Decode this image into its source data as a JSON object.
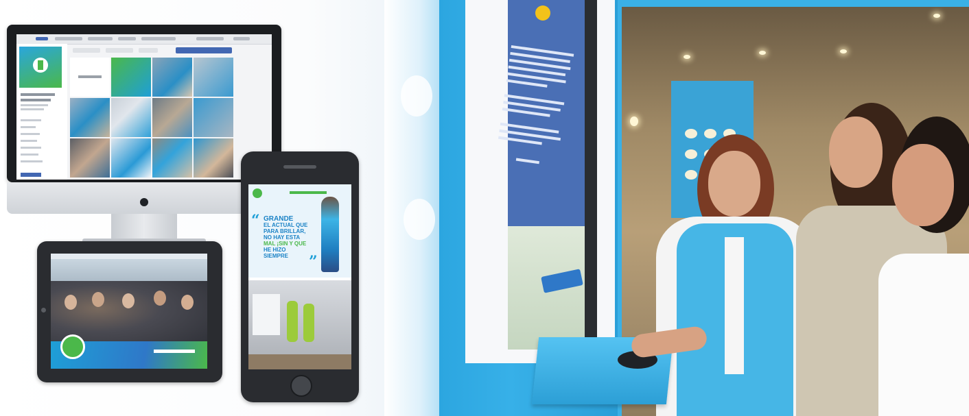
{
  "ad_headline": [
    "GRANDE",
    "EL ACTUAL QUE",
    "PARA BRILLAR,",
    "NO HAY ESTA",
    "MAL ¡SIN",
    "Y QUE",
    "HE HIZO SIEMPRE"
  ],
  "colors": {
    "brand_blue": "#1e9fd7",
    "brand_green": "#4bb84a",
    "booth_blue": "#37b0e8",
    "facebook_blue": "#4267b2"
  }
}
